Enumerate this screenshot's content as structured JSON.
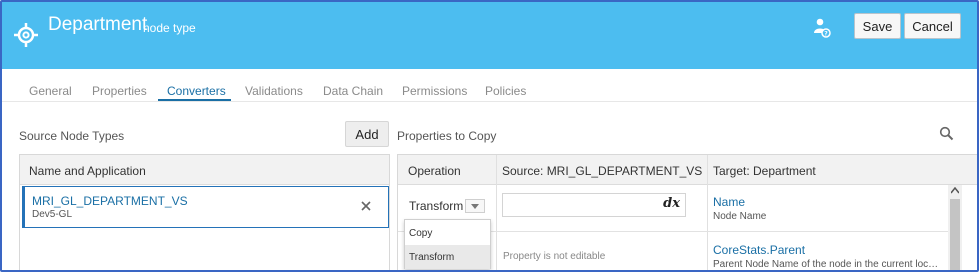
{
  "header": {
    "title": "Department",
    "subtitle": "node type",
    "save_label": "Save",
    "cancel_label": "Cancel",
    "background": "#4cbdf0"
  },
  "tabs": [
    {
      "label": "General",
      "active": false
    },
    {
      "label": "Properties",
      "active": false
    },
    {
      "label": "Converters",
      "active": true
    },
    {
      "label": "Validations",
      "active": false
    },
    {
      "label": "Data Chain",
      "active": false
    },
    {
      "label": "Permissions",
      "active": false
    },
    {
      "label": "Policies",
      "active": false
    }
  ],
  "source_panel": {
    "title": "Source Node Types",
    "add_label": "Add",
    "column_header": "Name and Application",
    "rows": [
      {
        "name": "MRI_GL_DEPARTMENT_VS",
        "application": "Dev5-GL",
        "selected": true
      }
    ]
  },
  "properties_panel": {
    "title": "Properties to Copy",
    "columns": {
      "operation": "Operation",
      "source": "Source: MRI_GL_DEPARTMENT_VS",
      "target": "Target: Department"
    },
    "rows": [
      {
        "operation": "Transform",
        "source_expression_icon": "dx",
        "target_name": "Name",
        "target_description": "Node Name"
      },
      {
        "source_note": "Property is not editable",
        "target_name": "CoreStats.Parent",
        "target_description": "Parent Node Name of the node in the current location"
      }
    ],
    "operation_dropdown": {
      "options": [
        "Copy",
        "Transform"
      ],
      "highlighted": "Transform"
    }
  },
  "colors": {
    "accent": "#1a6fa5",
    "selection_border": "#2472b8"
  }
}
